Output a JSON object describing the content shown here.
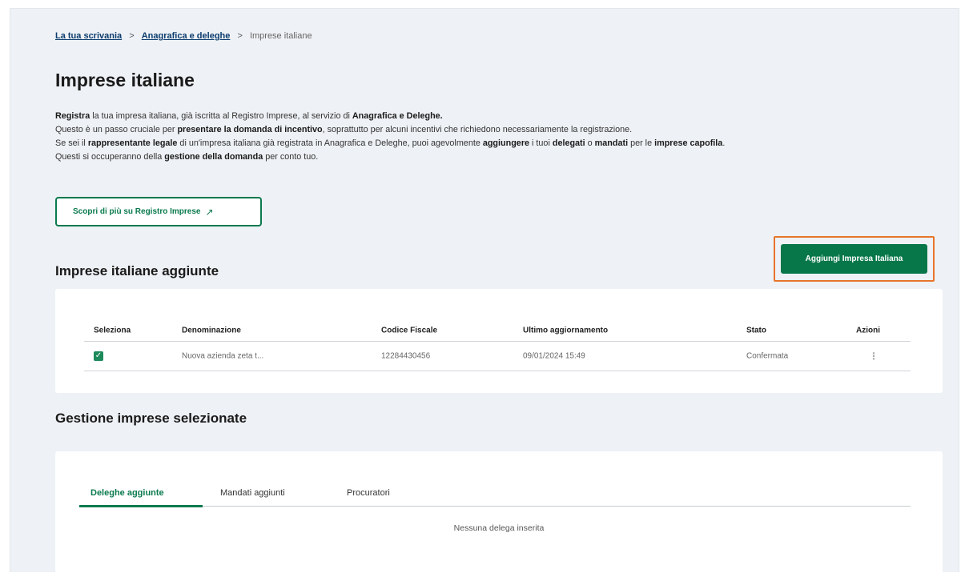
{
  "breadcrumb": {
    "items": [
      "La tua scrivania",
      "Anagrafica e deleghe"
    ],
    "current": "Imprese italiane",
    "separator": ">"
  },
  "page": {
    "title": "Imprese italiane"
  },
  "intro": {
    "line1": {
      "a": "Registra",
      "b": " la tua impresa italiana, già iscritta al Registro Imprese, al servizio di ",
      "c": "Anagrafica e Deleghe."
    },
    "line2": {
      "a": "Questo è un passo cruciale per ",
      "b": "presentare la domanda di incentivo",
      "c": ", soprattutto per alcuni incentivi che richiedono necessariamente la registrazione."
    },
    "line3": {
      "a": "Se sei il ",
      "b": "rappresentante legale",
      "c": " di un'impresa italiana già registrata in Anagrafica e Deleghe, puoi agevolmente ",
      "d": "aggiungere",
      "e": " i tuoi ",
      "f": "delegati",
      "g": " o ",
      "h": "mandati",
      "i": " per le ",
      "j": "imprese capofila",
      "k": "."
    },
    "line4": {
      "a": "Questi si occuperanno della ",
      "b": "gestione della domanda",
      "c": " per conto tuo."
    }
  },
  "registro_button": {
    "label": "Scopri di più su Registro Imprese",
    "icon": "external-link-icon",
    "icon_glyph": "↗"
  },
  "aggiunte": {
    "title": "Imprese italiane aggiunte",
    "add_button_label": "Aggiungi Impresa Italiana",
    "highlight_color": "#e8752b",
    "columns": [
      "Seleziona",
      "Denominazione",
      "Codice Fiscale",
      "Ultimo aggiornamento",
      "Stato",
      "Azioni"
    ],
    "rows": [
      {
        "checked": true,
        "check_glyph": "✓",
        "denominazione": "Nuova azienda zeta t...",
        "codice_fiscale": "12284430456",
        "ultimo_aggiornamento": "09/01/2024 15:49",
        "stato": "Confermata",
        "azioni_glyph": "⋮"
      }
    ]
  },
  "gestione": {
    "title": "Gestione imprese selezionate",
    "tabs": [
      "Deleghe aggiunte",
      "Mandati aggiunti",
      "Procuratori"
    ],
    "active_tab": 0,
    "empty_message": "Nessuna delega inserita"
  },
  "colors": {
    "primary": "#07774a",
    "background": "#eef1f5",
    "link": "#0c3c6e"
  }
}
